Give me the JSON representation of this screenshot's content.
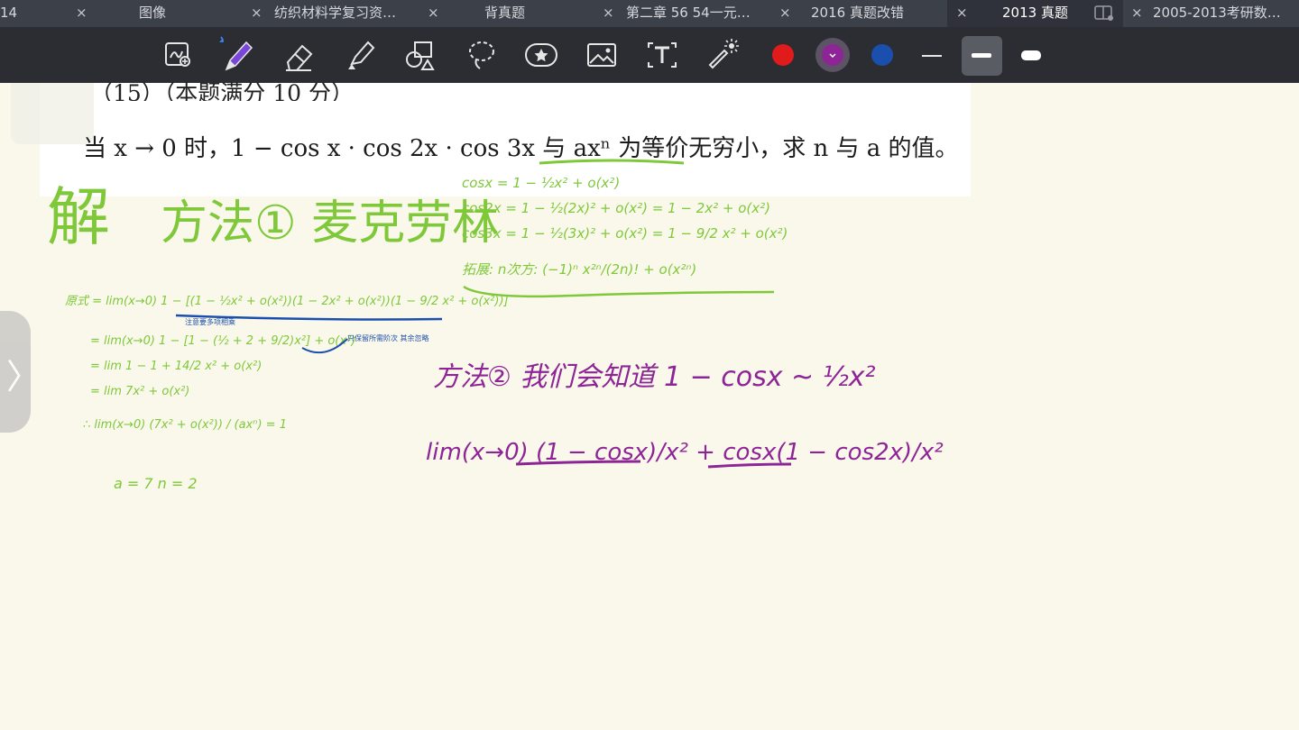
{
  "tabs": [
    {
      "label": "14",
      "active": false
    },
    {
      "label": "图像",
      "active": false
    },
    {
      "label": "纺织材料学复习资…",
      "active": false
    },
    {
      "label": "背真题",
      "active": false
    },
    {
      "label": "第二章 56 54一元…",
      "active": false
    },
    {
      "label": "2016 真题改错",
      "active": false
    },
    {
      "label": "2013 真题",
      "active": true
    },
    {
      "label": "2005-2013考研数…",
      "active": false
    }
  ],
  "close_glyph": "×",
  "toolbar": {
    "tools": [
      "lasso-pen-icon",
      "pen-icon",
      "eraser-icon",
      "highlighter-icon",
      "shapes-icon",
      "lasso-icon",
      "sticker-icon",
      "image-icon",
      "text-icon",
      "laser-pointer-icon"
    ],
    "colors": [
      "#e01b1b",
      "#8e2596",
      "#1a4fae"
    ],
    "selected_color": "#8e2596",
    "stroke_widths": [
      "thin",
      "medium",
      "thick"
    ],
    "selected_stroke": "medium"
  },
  "question": {
    "header": "（15）（本题满分 10 分）",
    "text": "当 x → 0 时，1 − cos x · cos 2x · cos 3x 与 axⁿ 为等价无穷小，求 n 与 a 的值。"
  },
  "handwriting": {
    "solve": "解",
    "method1": "方法① 麦克劳林",
    "cos_x": "cosx = 1 − ½x² + o(x²)",
    "cos_2x": "cos2x = 1 − ½(2x)² + o(x²) = 1 − 2x² + o(x²)",
    "cos_3x": "cos3x = 1 − ½(3x)² + o(x²) = 1 − 9/2 x² + o(x²)",
    "extension": "拓展: n次方: (−1)ⁿ x²ⁿ/(2n)! + o(x²ⁿ)",
    "line1": "原式 = lim(x→0) 1 − [(1 − ½x² + o(x²))(1 − 2x² + o(x²))(1 − 9/2 x² + o(x²))]",
    "note1": "注意要多项相乘",
    "line2": "= lim(x→0) 1 − [1 − (½ + 2 + 9/2)x²] + o(x²)",
    "note2": "只保留所需阶次 其余忽略",
    "line3": "= lim 1 − 1 + 14/2 x² + o(x²)",
    "line4": "= lim 7x² + o(x²)",
    "line5": "∴ lim(x→0) (7x² + o(x²)) / (axⁿ) = 1",
    "answer": "a = 7   n = 2",
    "method2": "方法② 我们会知道 1 − cosx ~ ½x²",
    "limit_expr": "lim(x→0) (1 − cosx)/x² + cosx(1 − cos2x)/x²"
  }
}
